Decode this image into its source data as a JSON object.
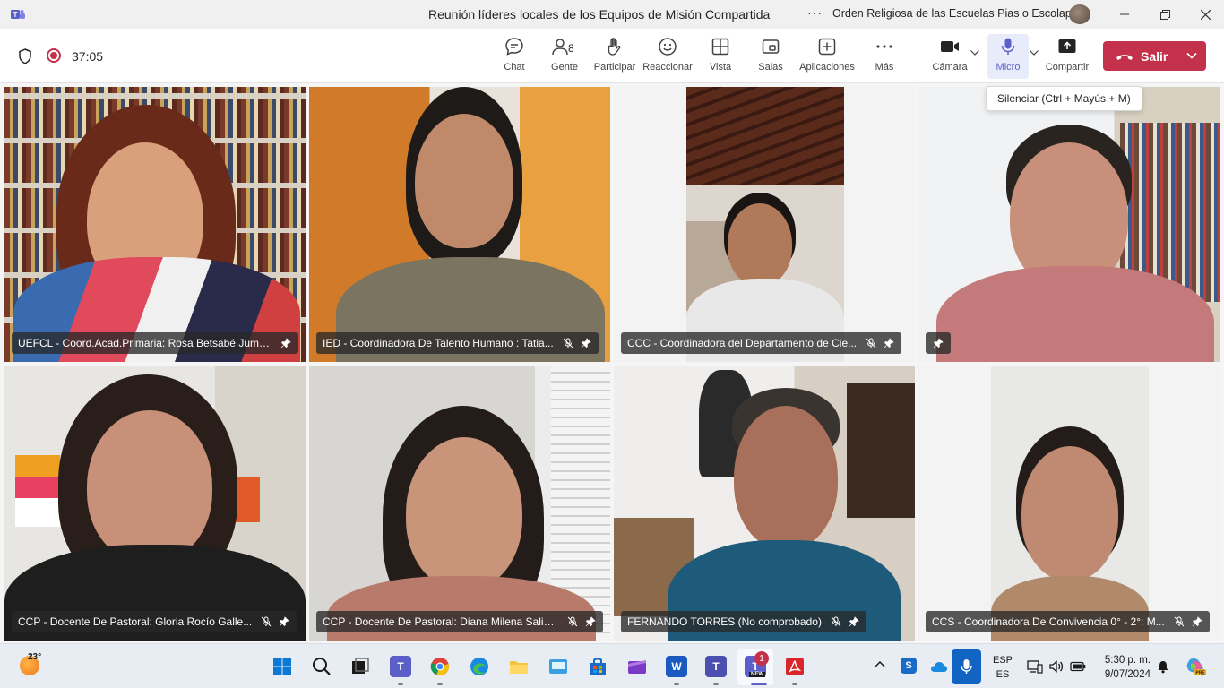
{
  "window": {
    "title": "Reunión líderes locales de los Equipos de Misión Compartida",
    "more_dots": "···",
    "org_name": "Orden Religiosa de las Escuelas Pias o Escolapios"
  },
  "toolbar": {
    "timer": "37:05",
    "people_count": "8",
    "buttons": {
      "chat": "Chat",
      "people": "Gente",
      "raise": "Participar",
      "react": "Reaccionar",
      "view": "Vista",
      "rooms": "Salas",
      "apps": "Aplicaciones",
      "more": "Más",
      "camera": "Cámara",
      "mic": "Micro",
      "share": "Compartir",
      "leave": "Salir"
    },
    "tooltip": "Silenciar (Ctrl + Mayús + M)"
  },
  "participants": [
    {
      "name": "UEFCL - Coord.Acad.Primaria: Rosa Betsabé Jumbo...",
      "muted": false
    },
    {
      "name": "IED - Coordinadora De Talento Humano : Tatia...",
      "muted": true
    },
    {
      "name": "CCC - Coordinadora del Departamento de Cie...",
      "muted": true
    },
    {
      "name": "",
      "muted": false
    },
    {
      "name": "CCP - Docente De Pastoral: Gloria Rocío Galle...",
      "muted": true
    },
    {
      "name": "CCP - Docente De Pastoral: Diana Milena Salin...",
      "muted": true
    },
    {
      "name": "FERNANDO TORRES (No comprobado)",
      "muted": true
    },
    {
      "name": "CCS - Coordinadora De Convivencia 0° - 2°: M...",
      "muted": true
    }
  ],
  "taskbar": {
    "temperature": "23°",
    "lang_top": "ESP",
    "lang_bottom": "ES",
    "time": "5:30 p. m.",
    "date": "9/07/2024",
    "teams_badge": "1",
    "new_label": "NEW"
  },
  "colors": {
    "leave": "#c4314b",
    "accent": "#5b5fc7",
    "recording": "#c4314b"
  }
}
